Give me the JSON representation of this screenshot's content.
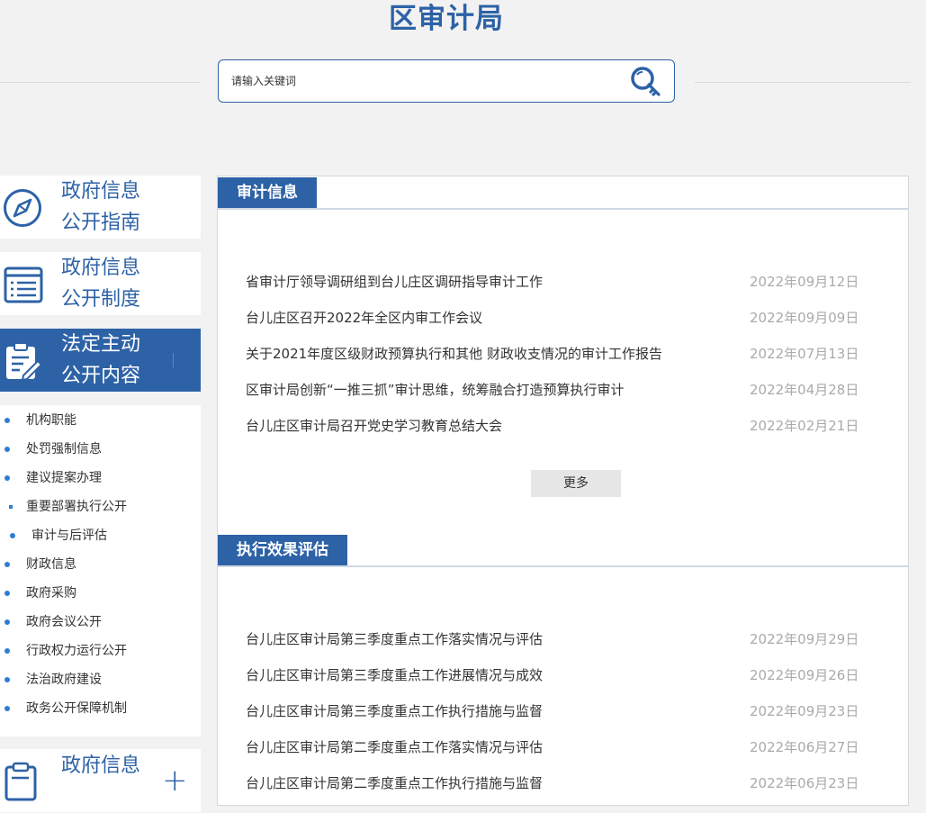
{
  "header": {
    "title": "区审计局"
  },
  "search": {
    "placeholder": "请输入关键词",
    "button_icon": "search-key-icon"
  },
  "sidebar": {
    "cards": [
      {
        "line1": "政府信息",
        "line2": "公开指南",
        "icon": "compass-icon"
      },
      {
        "line1": "政府信息",
        "line2": "公开制度",
        "icon": "list-document-icon"
      },
      {
        "line1": "法定主动",
        "line2": "公开内容",
        "icon": "clipboard-edit-icon"
      },
      {
        "line1": "政府信息",
        "line2": "",
        "icon": "document-icon"
      }
    ],
    "items": [
      "机构职能",
      "处罚强制信息",
      "建议提案办理",
      "重要部署执行公开",
      "审计与后评估",
      "财政信息",
      "政府采购",
      "政府会议公开",
      "行政权力运行公开",
      "法治政府建设",
      "政务公开保障机制"
    ]
  },
  "sections": [
    {
      "title": "审计信息",
      "items": [
        {
          "title": "省审计厅领导调研组到台儿庄区调研指导审计工作",
          "date": "2022年09月12日"
        },
        {
          "title": "台儿庄区召开2022年全区内审工作会议",
          "date": "2022年09月09日"
        },
        {
          "title": "关于2021年度区级财政预算执行和其他 财政收支情况的审计工作报告",
          "date": "2022年07月13日"
        },
        {
          "title": "区审计局创新“一推三抓”审计思维，统筹融合打造预算执行审计",
          "date": "2022年04月28日"
        },
        {
          "title": "台儿庄区审计局召开党史学习教育总结大会",
          "date": "2022年02月21日"
        }
      ],
      "more_label": "更多"
    },
    {
      "title": "执行效果评估",
      "items": [
        {
          "title": "台儿庄区审计局第三季度重点工作落实情况与评估",
          "date": "2022年09月29日"
        },
        {
          "title": "台儿庄区审计局第三季度重点工作进展情况与成效",
          "date": "2022年09月26日"
        },
        {
          "title": "台儿庄区审计局第三季度重点工作执行措施与监督",
          "date": "2022年09月23日"
        },
        {
          "title": "台儿庄区审计局第二季度重点工作落实情况与评估",
          "date": "2022年06月27日"
        },
        {
          "title": "台儿庄区审计局第二季度重点工作执行措施与监督",
          "date": "2022年06月23日"
        }
      ]
    }
  ],
  "colors": {
    "brand": "#2d62a6",
    "page_bg": "#f2f2f2",
    "date": "#aaaaaa",
    "bullet": "#2d7ed3"
  }
}
